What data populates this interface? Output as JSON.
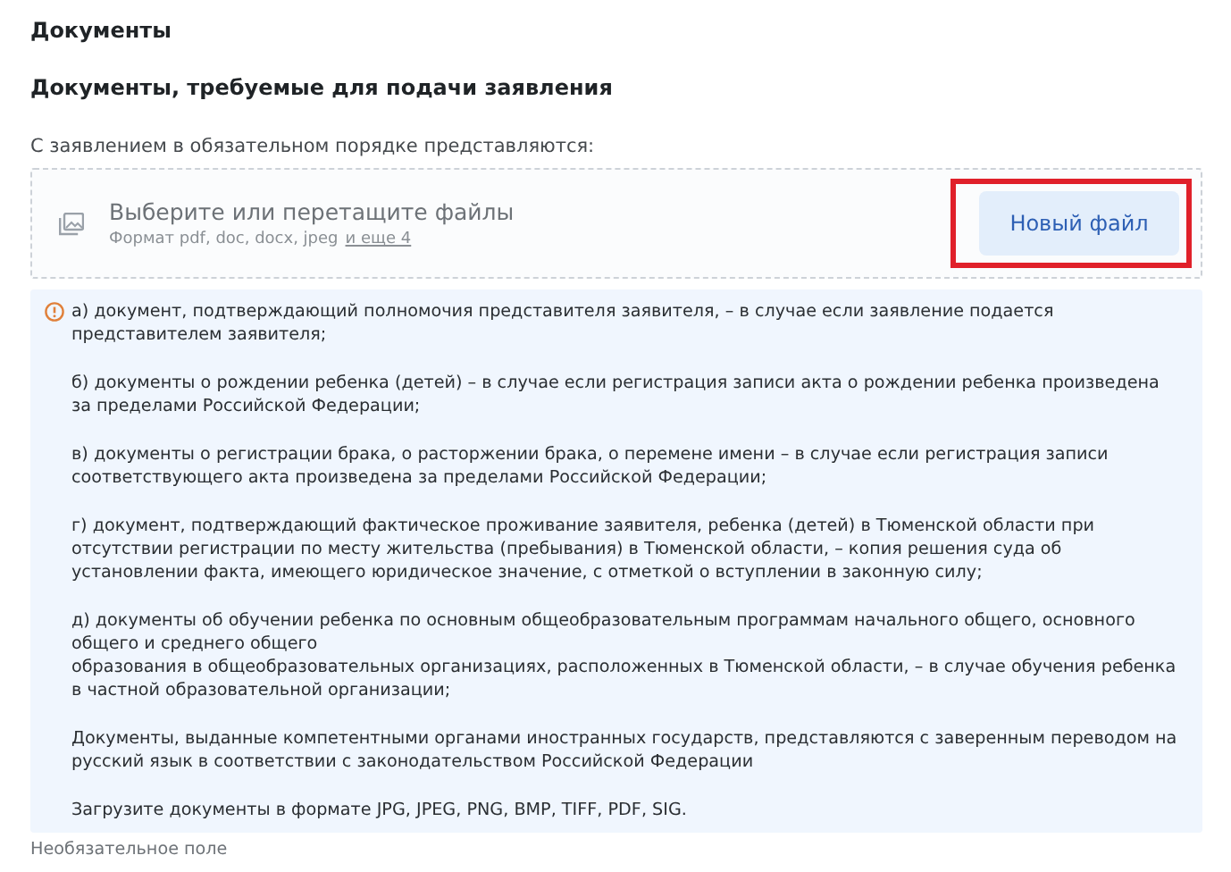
{
  "section_title": "Документы",
  "group_title": "Документы, требуемые для подачи заявления",
  "field_label": "С заявлением в обязательном порядке представляются:",
  "dropzone": {
    "prompt": "Выберите или перетащите файлы",
    "formats": "Формат pdf, doc, docx, jpeg",
    "more_link": "и еще 4",
    "button": {
      "label": "Новый файл",
      "highlighted": true
    }
  },
  "info": {
    "paragraphs": [
      "а) документ, подтверждающий полномочия представителя заявителя, – в случае если заявление подается представителем заявителя;",
      "б) документы о рождении ребенка (детей) – в случае если регистрация записи акта о рождении ребенка произведена за пределами Российской Федерации;",
      "в) документы о регистрации брака, о расторжении брака, о перемене имени – в случае если регистрация записи соответствующего акта произведена за пределами Российской Федерации;",
      "г) документ, подтверждающий фактическое проживание заявителя, ребенка (детей) в Тюменской области при отсутствии регистрации по месту жительства (пребывания) в Тюменской области, – копия решения суда об установлении факта, имеющего юридическое значение, с отметкой о вступлении в законную силу;",
      "д) документы об обучении ребенка по основным общеобразовательным программам начального общего, основного общего и среднего общего\nобразования в общеобразовательных организациях, расположенных в Тюменской области, – в случае обучения ребенка в частной образовательной организации;",
      "Документы, выданные компетентными органами иностранных государств, представляются с заверенным переводом на русский язык в соответствии с законодательством Российской Федерации",
      "Загрузите документы в формате JPG, JPEG, PNG, BMP, TIFF, PDF, SIG."
    ]
  },
  "hint": "Необязательное поле"
}
